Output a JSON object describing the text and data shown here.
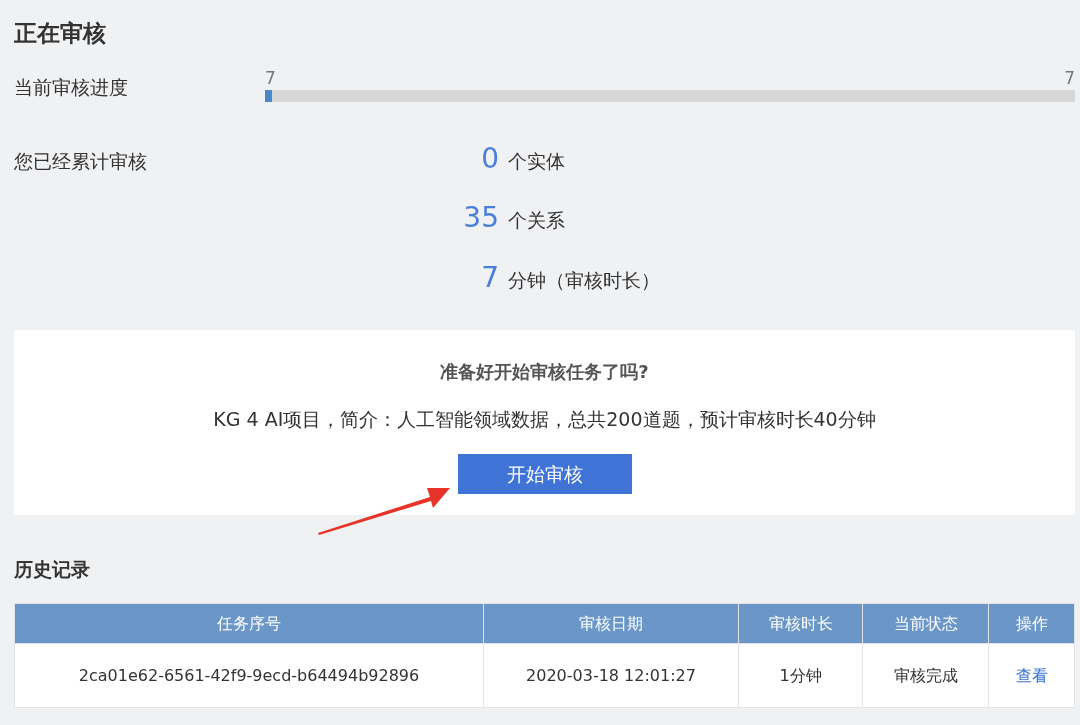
{
  "title": "正在审核",
  "progress": {
    "label": "当前审核进度",
    "start_label": "7",
    "end_label": "7",
    "level": 0.009
  },
  "totals": {
    "label": "您已经累计审核",
    "items": [
      {
        "value": "0",
        "unit": "个实体"
      },
      {
        "value": "35",
        "unit": "个关系"
      },
      {
        "value": "7",
        "unit": "分钟（审核时长）"
      }
    ]
  },
  "task_card": {
    "question": "准备好开始审核任务了吗?",
    "description": "KG 4 AI项目，简介：人工智能领域数据，总共200道题，预计审核时长40分钟",
    "button": "开始审核"
  },
  "history": {
    "title": "历史记录",
    "columns": [
      "任务序号",
      "审核日期",
      "审核时长",
      "当前状态",
      "操作"
    ],
    "rows": [
      {
        "id": "2ca01e62-6561-42f9-9ecd-b64494b92896",
        "date": "2020-03-18 12:01:27",
        "duration": "1分钟",
        "status": "审核完成",
        "action": "查看"
      }
    ]
  }
}
